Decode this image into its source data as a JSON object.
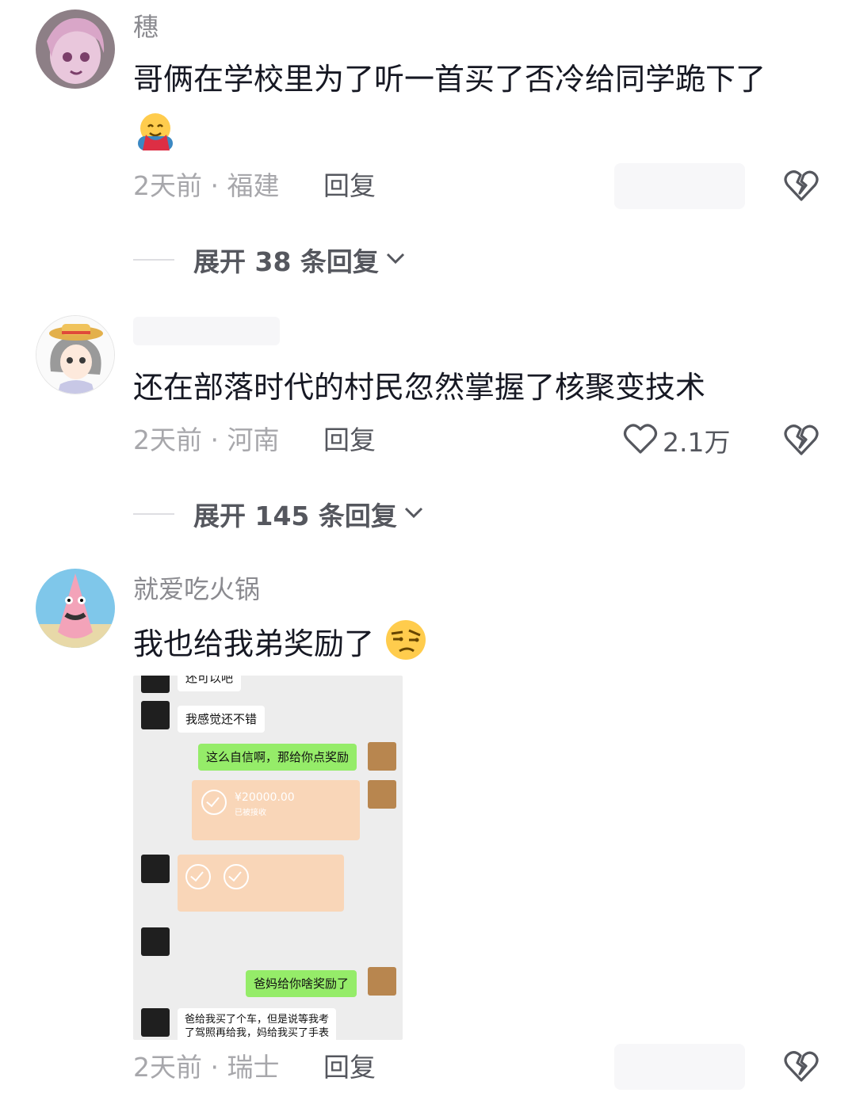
{
  "comments": [
    {
      "username": "穗",
      "text": "哥俩在学校里为了听一首买了否冷给同学跪下了",
      "meta": "2天前 · 福建",
      "reply_label": "回复",
      "expand_label": "展开 38 条回复"
    },
    {
      "username": "",
      "text": "还在部落时代的村民忽然掌握了核聚变技术",
      "meta": "2天前 · 河南",
      "reply_label": "回复",
      "like_count": "2.1万",
      "expand_label": "展开 145 条回复"
    },
    {
      "username": "就爱吃火锅",
      "text": "我也给我弟奖励了",
      "meta": "2天前 · 瑞士",
      "reply_label": "回复"
    }
  ],
  "chat_screenshot": {
    "msg_top": "还可以吧",
    "msg1": "我感觉还不错",
    "msg2": "这么自信啊，那给你点奖励",
    "amount": "¥20000.00",
    "status": "已被接收",
    "msg3": "爸妈给你啥奖励了",
    "msg4_line1": "爸给我买了个车，但是说等我考",
    "msg4_line2": "了驾照再给我，妈给我买了手表"
  },
  "icons": {
    "hug_emoji": "hugging-face-emoji",
    "side_eye_emoji": "unamused-face-emoji",
    "dislike": "broken-heart-icon",
    "like": "heart-outline-icon",
    "chevron": "chevron-down-icon"
  },
  "colors": {
    "meta_gray": "#a7a7ab",
    "text_dark": "#161823",
    "wechat_green": "#95ec69",
    "transfer_orange": "#f9d6b8"
  }
}
